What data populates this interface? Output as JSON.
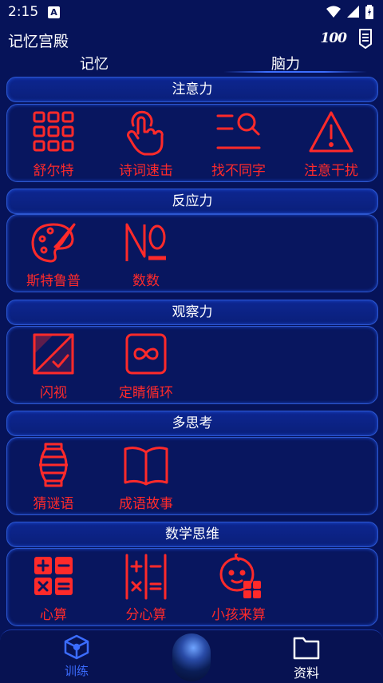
{
  "status_bar": {
    "time": "2:15",
    "notification_badge": "A"
  },
  "app_bar": {
    "title": "记忆宫殿",
    "score_icon": "100",
    "menu_icon": "document-list-icon"
  },
  "tabs": {
    "memory": "记忆",
    "brain": "脑力",
    "selected": "脑力"
  },
  "accent_color": "#ff2a2a",
  "sections": [
    {
      "title": "注意力",
      "items": [
        {
          "label": "舒尔特",
          "icon": "grid-icon"
        },
        {
          "label": "诗词速击",
          "icon": "tap-hand-icon"
        },
        {
          "label": "找不同字",
          "icon": "search-list-icon"
        },
        {
          "label": "注意干扰",
          "icon": "warning-icon"
        }
      ]
    },
    {
      "title": "反应力",
      "items": [
        {
          "label": "斯特鲁普",
          "icon": "palette-icon"
        },
        {
          "label": "数数",
          "icon": "number-sign-icon"
        }
      ]
    },
    {
      "title": "观察力",
      "items": [
        {
          "label": "闪视",
          "icon": "flash-card-icon"
        },
        {
          "label": "定睛循环",
          "icon": "infinity-icon"
        }
      ]
    },
    {
      "title": "多思考",
      "items": [
        {
          "label": "猜谜语",
          "icon": "lantern-icon"
        },
        {
          "label": "成语故事",
          "icon": "book-icon"
        }
      ]
    },
    {
      "title": "数学思维",
      "items": [
        {
          "label": "心算",
          "icon": "calculator-icon"
        },
        {
          "label": "分心算",
          "icon": "split-calc-icon"
        },
        {
          "label": "小孩来算",
          "icon": "child-calc-icon"
        }
      ]
    }
  ],
  "bottom_nav": {
    "train": "训练",
    "data": "资料",
    "selected": "训练"
  }
}
